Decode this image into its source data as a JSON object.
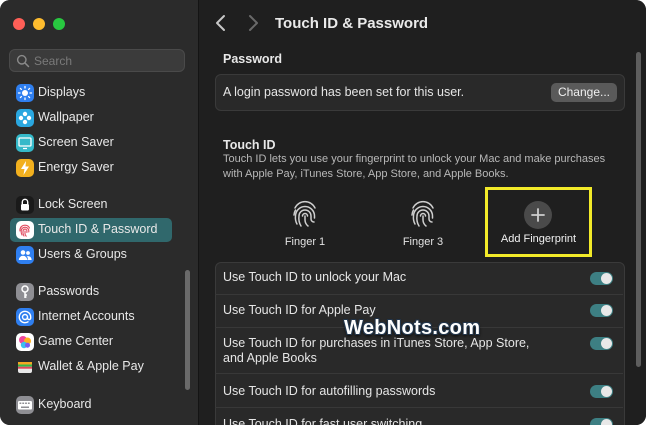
{
  "window": {
    "title": "Touch ID & Password"
  },
  "search": {
    "placeholder": "Search"
  },
  "sidebar": {
    "items": [
      {
        "label": "Displays",
        "icon": "displays-icon"
      },
      {
        "label": "Wallpaper",
        "icon": "wallpaper-icon"
      },
      {
        "label": "Screen Saver",
        "icon": "screen-saver-icon"
      },
      {
        "label": "Energy Saver",
        "icon": "energy-saver-icon"
      },
      {
        "label": "Lock Screen",
        "icon": "lock-screen-icon"
      },
      {
        "label": "Touch ID & Password",
        "icon": "fingerprint-icon",
        "selected": true
      },
      {
        "label": "Users & Groups",
        "icon": "users-groups-icon"
      },
      {
        "label": "Passwords",
        "icon": "key-icon"
      },
      {
        "label": "Internet Accounts",
        "icon": "at-sign-icon"
      },
      {
        "label": "Game Center",
        "icon": "game-center-icon"
      },
      {
        "label": "Wallet & Apple Pay",
        "icon": "wallet-icon"
      },
      {
        "label": "Keyboard",
        "icon": "keyboard-icon"
      }
    ]
  },
  "password": {
    "section_title": "Password",
    "status_text": "A login password has been set for this user.",
    "change_label": "Change..."
  },
  "touch_id": {
    "section_title": "Touch ID",
    "description": "Touch ID lets you use your fingerprint to unlock your Mac and make purchases with Apple Pay, iTunes Store, App Store, and Apple Books.",
    "fingers": [
      {
        "label": "Finger 1"
      },
      {
        "label": "Finger 3"
      }
    ],
    "add_label": "Add Fingerprint"
  },
  "options": [
    {
      "label": "Use Touch ID to unlock your Mac",
      "enabled": true
    },
    {
      "label": "Use Touch ID for Apple Pay",
      "enabled": true
    },
    {
      "label": "Use Touch ID for purchases in iTunes Store, App Store, and Apple Books",
      "enabled": true
    },
    {
      "label": "Use Touch ID for autofilling passwords",
      "enabled": true
    },
    {
      "label": "Use Touch ID for fast user switching",
      "enabled": true
    }
  ],
  "watermark": "WebNots.com",
  "colors": {
    "accent": "#3d7f83",
    "selected_item": "#30686c",
    "highlight": "#f2ea29"
  }
}
